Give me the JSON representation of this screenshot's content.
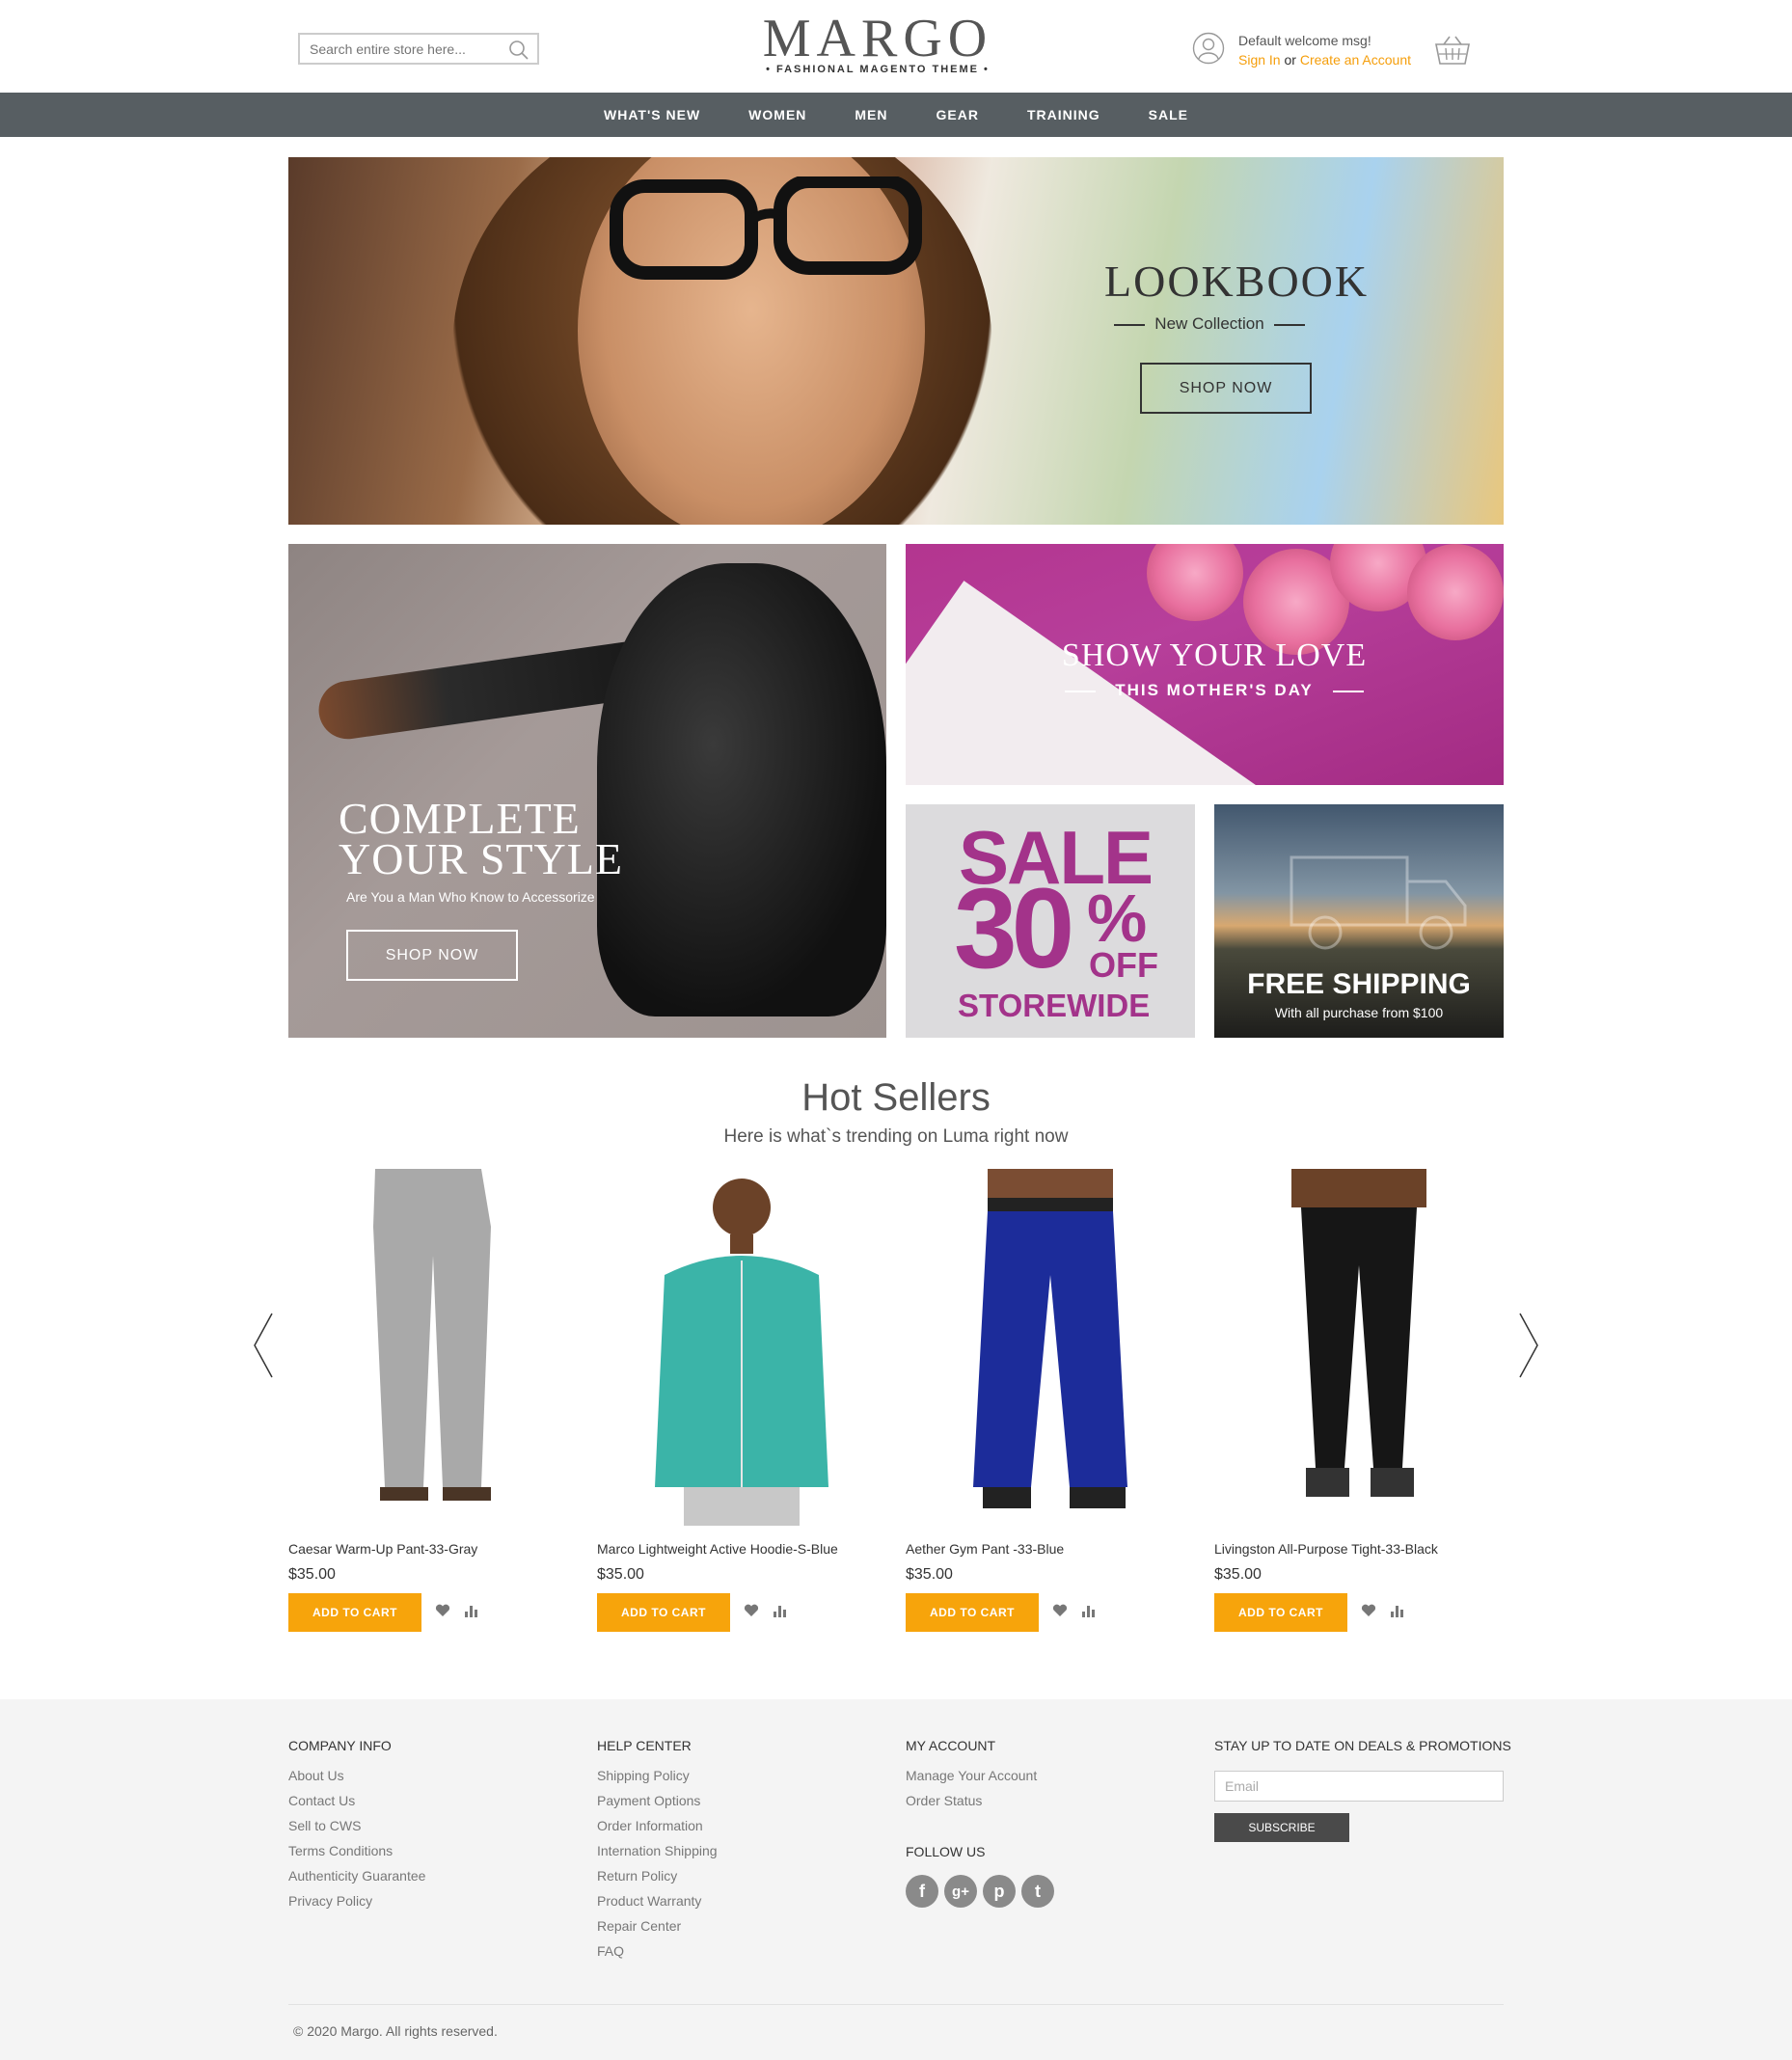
{
  "header": {
    "search_placeholder": "Search entire store here...",
    "logo_title": "MARGO",
    "logo_subtitle": "• FASHIONAL MAGENTO THEME •",
    "welcome": "Default welcome msg!",
    "sign_in": "Sign In",
    "or": "or",
    "create_account": "Create an Account"
  },
  "nav": [
    "WHAT'S NEW",
    "WOMEN",
    "MEN",
    "GEAR",
    "TRAINING",
    "SALE"
  ],
  "hero": {
    "title": "LOOKBOOK",
    "subtitle": "New Collection",
    "button": "SHOP NOW"
  },
  "banner_style": {
    "line1": "COMPLETE",
    "line2": "YOUR STYLE",
    "subtitle": "Are You a Man Who Know to Accessorize",
    "button": "SHOP NOW"
  },
  "banner_love": {
    "title": "SHOW YOUR LOVE",
    "subtitle": "THIS MOTHER'S DAY"
  },
  "banner_sale": {
    "line1": "SALE",
    "line2": "30",
    "percent": "%",
    "off": "OFF",
    "line3": "STOREWIDE"
  },
  "banner_shipping": {
    "title": "FREE SHIPPING",
    "subtitle": "With all purchase from $100"
  },
  "hot_sellers": {
    "title": "Hot Sellers",
    "subtitle": "Here is what`s trending on Luma right now",
    "add_to_cart": "ADD TO CART",
    "products": [
      {
        "name": "Caesar Warm-Up Pant-33-Gray",
        "price": "$35.00"
      },
      {
        "name": "Marco Lightweight Active Hoodie-S-Blue",
        "price": "$35.00"
      },
      {
        "name": "Aether Gym Pant -33-Blue",
        "price": "$35.00"
      },
      {
        "name": "Livingston All-Purpose Tight-33-Black",
        "price": "$35.00"
      }
    ]
  },
  "footer": {
    "company": {
      "title": "COMPANY INFO",
      "links": [
        "About Us",
        "Contact Us",
        "Sell to CWS",
        "Terms Conditions",
        "Authenticity Guarantee",
        "Privacy Policy"
      ]
    },
    "help": {
      "title": "HELP CENTER",
      "links": [
        "Shipping Policy",
        "Payment Options",
        "Order Information",
        "Internation Shipping",
        "Return Policy",
        "Product Warranty",
        "Repair Center",
        "FAQ"
      ]
    },
    "account": {
      "title": "MY ACCOUNT",
      "links": [
        "Manage Your Account",
        "Order Status"
      ]
    },
    "follow_title": "FOLLOW US",
    "social": [
      "f",
      "g+",
      "p",
      "t"
    ],
    "newsletter_title": "STAY UP TO DATE ON DEALS & PROMOTIONS",
    "email_placeholder": "Email",
    "subscribe": "SUBSCRIBE",
    "copyright": "© 2020 Margo. All rights reserved."
  },
  "colors": {
    "accent": "#f7a40b",
    "nav": "#575e62",
    "sale": "#a3338a"
  }
}
